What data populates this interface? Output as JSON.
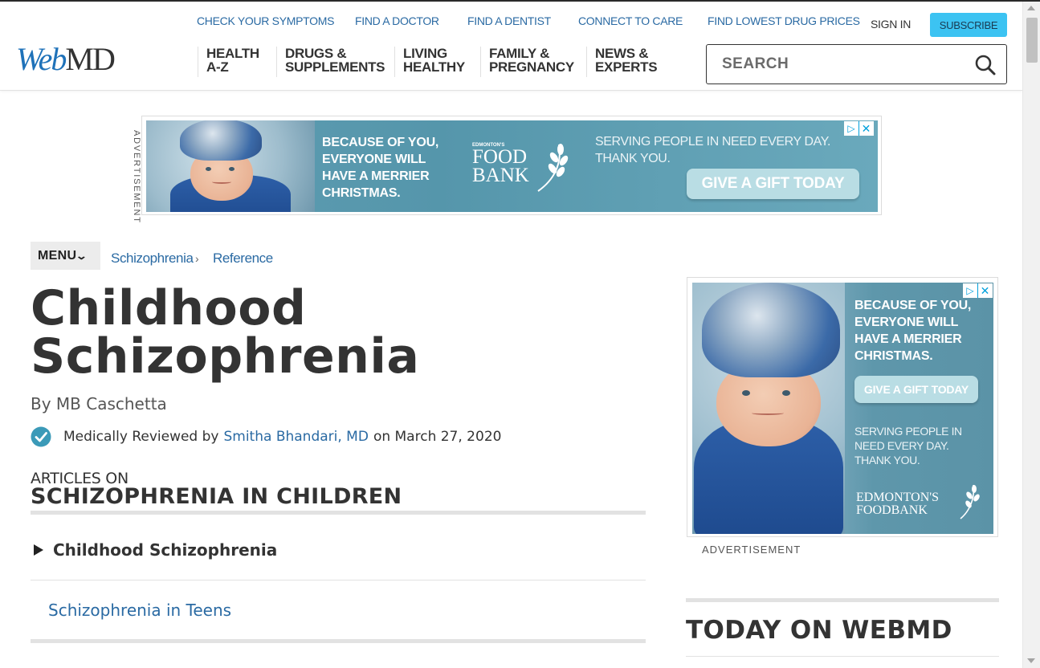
{
  "header": {
    "utility_links": [
      "CHECK YOUR SYMPTOMS",
      "FIND A DOCTOR",
      "FIND A DENTIST",
      "CONNECT TO CARE",
      "FIND LOWEST DRUG PRICES"
    ],
    "sign_in": "SIGN IN",
    "subscribe": "SUBSCRIBE",
    "logo": {
      "web": "Web",
      "md": "MD"
    },
    "nav": [
      {
        "line1": "HEALTH",
        "line2": "A-Z"
      },
      {
        "line1": "DRUGS &",
        "line2": "SUPPLEMENTS"
      },
      {
        "line1": "LIVING",
        "line2": "HEALTHY"
      },
      {
        "line1": "FAMILY &",
        "line2": "PREGNANCY"
      },
      {
        "line1": "NEWS &",
        "line2": "EXPERTS"
      }
    ],
    "search_placeholder": "SEARCH"
  },
  "ad_top": {
    "label": "ADVERTISEMENT",
    "headline": [
      "BECAUSE OF YOU,",
      "EVERYONE WILL",
      "HAVE A MERRIER",
      "CHRISTMAS."
    ],
    "foodbank_small": "EDMONTON'S",
    "foodbank": [
      "FOOD",
      "BANK"
    ],
    "tagline": [
      "SERVING PEOPLE IN NEED EVERY DAY.",
      "THANK YOU."
    ],
    "cta": "GIVE A GIFT TODAY"
  },
  "breadcrumb": {
    "menu": "MENU",
    "items": [
      "Schizophrenia",
      "Reference"
    ],
    "separator": "›"
  },
  "article": {
    "title_line1": "Childhood",
    "title_line2": "Schizophrenia",
    "byline": "By MB Caschetta",
    "reviewed_prefix": "Medically Reviewed by",
    "reviewer": "Smitha Bhandari, MD",
    "reviewed_suffix": "on March 27, 2020",
    "articles_on": "ARTICLES ON",
    "articles_topic": "SCHIZOPHRENIA IN CHILDREN",
    "articles": [
      {
        "label": "Childhood Schizophrenia",
        "active": true
      },
      {
        "label": "Schizophrenia in Teens",
        "active": false
      }
    ]
  },
  "ad_right": {
    "label": "ADVERTISEMENT",
    "headline": [
      "BECAUSE OF YOU,",
      "EVERYONE WILL",
      "HAVE A MERRIER",
      "CHRISTMAS."
    ],
    "cta": "GIVE A GIFT TODAY",
    "tagline": [
      "SERVING PEOPLE IN",
      "NEED EVERY DAY.",
      "THANK YOU."
    ],
    "foodbank": [
      "EDMONTON'S",
      "FOODBANK"
    ]
  },
  "sidebar": {
    "today_title": "TODAY ON WEBMD"
  },
  "colors": {
    "link": "#2a6aa3",
    "subscribe": "#3cc3f2",
    "check": "#3b9ab8",
    "logo_web": "#1f72b9"
  }
}
